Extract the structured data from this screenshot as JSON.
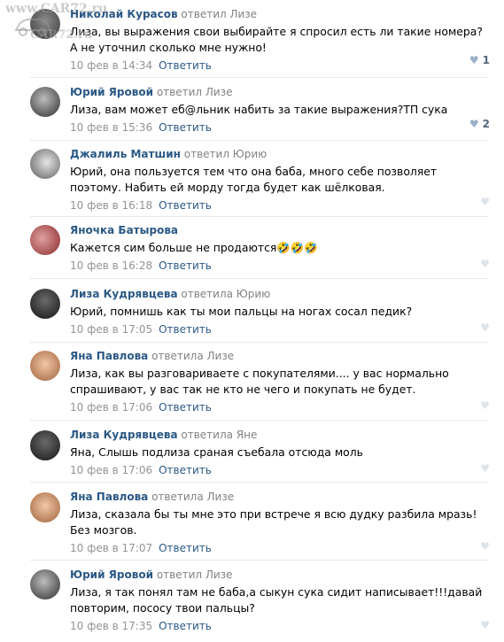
{
  "watermark": {
    "line1": "www.CAR72.ru",
    "line2": "CAR72.ru"
  },
  "reply_label": "Ответить",
  "comments": [
    {
      "author": "Николай Курасов",
      "replied": "ответил Лизе",
      "text": "Лиза, вы выражения свои выбирайте я спросил есть ли такие номера?А не уточнил сколько мне нужно!",
      "date": "10 фев в 14:34",
      "likes": "1"
    },
    {
      "author": "Юрий Яровой",
      "replied": "ответил Лизе",
      "text": "Лиза, вам может еб@льник набить за такие выражения?ТП сука",
      "date": "10 фев в 15:36",
      "likes": "2"
    },
    {
      "author": "Джалиль Матшин",
      "replied": "ответил Юрию",
      "text": "Юрий, она пользуется тем что она баба, много себе позволяет поэтому. Набить ей морду тогда будет как шёлковая.",
      "date": "10 фев в 16:18",
      "likes": ""
    },
    {
      "author": "Яночка Батырова",
      "replied": "",
      "text": "Кажется сим больше не продаются🤣🤣🤣",
      "date": "10 фев в 16:28",
      "likes": ""
    },
    {
      "author": "Лиза Кудрявцева",
      "replied": "ответила Юрию",
      "text": "Юрий, помнишь как ты мои пальцы на ногах сосал педик?",
      "date": "10 фев в 17:05",
      "likes": ""
    },
    {
      "author": "Яна Павлова",
      "replied": "ответила Лизе",
      "text": "Лиза, как вы разговариваете с покупателями.... у вас нормально спрашивают, у вас так не кто не чего и покупать не будет.",
      "date": "10 фев в 17:06",
      "likes": ""
    },
    {
      "author": "Лиза Кудрявцева",
      "replied": "ответила Яне",
      "text": "Яна, Слышь подлиза сраная съебала отсюда моль",
      "date": "10 фев в 17:06",
      "likes": ""
    },
    {
      "author": "Яна Павлова",
      "replied": "ответила Лизе",
      "text": "Лиза, сказала бы ты мне это при встрече я всю дудку разбила мразь! Без мозгов.",
      "date": "10 фев в 17:07",
      "likes": ""
    },
    {
      "author": "Юрий Яровой",
      "replied": "ответил Лизе",
      "text": "Лиза, я так понял там не баба,а сыкун сука сидит написывает!!!давай повторим, пососу твои пальцы?",
      "date": "10 фев в 17:35",
      "likes": ""
    }
  ]
}
